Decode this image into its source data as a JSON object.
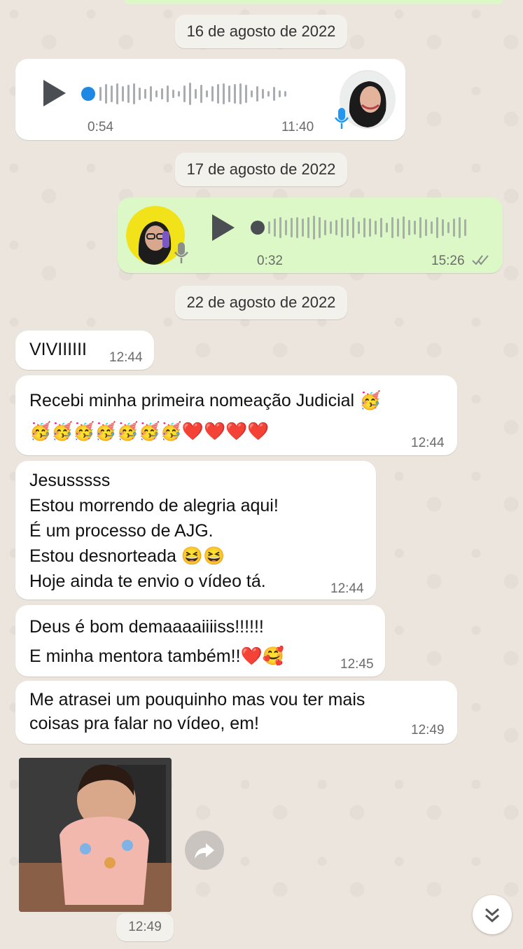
{
  "colors": {
    "background": "#ECE5DD",
    "incoming": "#FFFFFF",
    "outgoing": "#DCF8C6",
    "voice_dot_in": "#1e88e5",
    "voice_dot_out": "#4b4f54",
    "mic": "#2196F3"
  },
  "dates": [
    "16 de agosto de 2022",
    "17 de agosto de 2022",
    "22 de agosto de 2022"
  ],
  "voice_in": {
    "duration": "0:54",
    "time": "11:40",
    "icon": "microphone-icon"
  },
  "voice_out": {
    "duration": "0:32",
    "time": "15:26",
    "status_icon": "double-check-icon",
    "icon": "microphone-icon"
  },
  "messages": [
    {
      "text": "VIVIIIIII",
      "time": "12:44"
    },
    {
      "text": "Recebi minha primeira nomeação Judicial 🥳\n🥳🥳🥳🥳🥳🥳🥳❤️❤️❤️❤️",
      "time": "12:44"
    },
    {
      "text": "Jesusssss\nEstou morrendo de alegria aqui!\nÉ um processo de AJG.\nEstou desnorteada 😆😆\nHoje ainda te envio o vídeo tá.",
      "time": "12:44"
    },
    {
      "text": "Deus é bom demaaaaiiiiss!!!!!!\nE minha mentora também!!❤️🥰",
      "time": "12:45"
    },
    {
      "text": "Me atrasei um pouquinho mas vou ter mais\ncoisas pra falar no vídeo, em!",
      "time": "12:49"
    }
  ],
  "video": {
    "time": "12:49",
    "icon": "forward-icon"
  },
  "scroll_icon": "chevron-double-down-icon"
}
